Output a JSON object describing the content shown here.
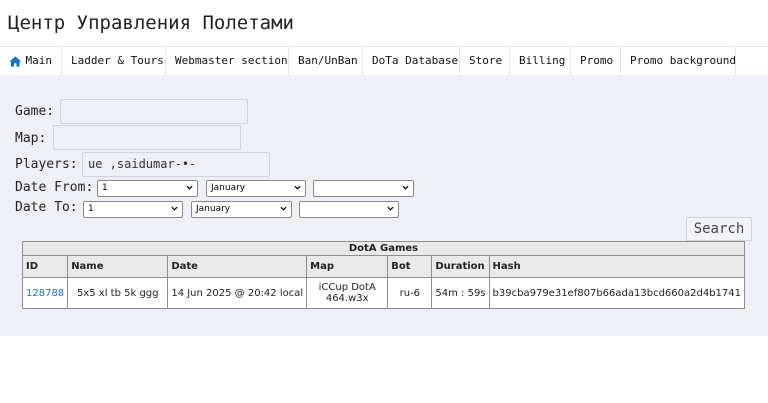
{
  "header": {
    "title": "Центр Управления Полетами"
  },
  "nav": {
    "items": [
      {
        "label": "Main",
        "icon": "home-icon"
      },
      {
        "label": "Ladder & Tours"
      },
      {
        "label": "Webmaster section"
      },
      {
        "label": "Ban/UnBan"
      },
      {
        "label": "DoTa Database"
      },
      {
        "label": "Store"
      },
      {
        "label": "Billing"
      },
      {
        "label": "Promo"
      },
      {
        "label": "Promo background"
      }
    ]
  },
  "form": {
    "game_label": "Game:",
    "game_value": "",
    "map_label": "Map:",
    "map_value": "",
    "players_label": "Players:",
    "players_value": "ue ,saidumar-•-",
    "date_from_label": "Date From:",
    "date_from": {
      "day": "1",
      "month": "January",
      "year": ""
    },
    "date_to_label": "Date To:",
    "date_to": {
      "day": "1",
      "month": "January",
      "year": ""
    },
    "search_label": "Search"
  },
  "table": {
    "caption": "DotA Games",
    "headers": [
      "ID",
      "Name",
      "Date",
      "Map",
      "Bot",
      "Duration",
      "Hash"
    ],
    "rows": [
      {
        "id": "128788",
        "name": "5x5 xl tb 5k ggg",
        "date": "14 Jun 2025 @ 20:42 local",
        "map_line1": "iCCup DotA",
        "map_line2": "464.w3x",
        "bot": "ru-6",
        "duration": "54m : 59s",
        "hash": "b39cba979e31ef807b66ada13bcd660a2d4b1741"
      }
    ]
  },
  "colors": {
    "link": "#1a6fd0",
    "home_icon": "#1a6fd0",
    "content_bg": "#eef0f5"
  }
}
